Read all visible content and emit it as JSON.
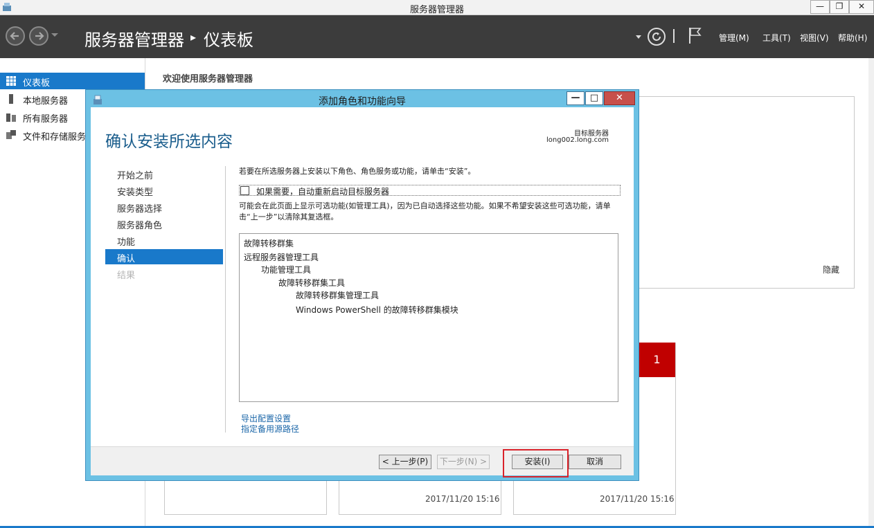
{
  "window": {
    "title": "服务器管理器",
    "controls": [
      "minimize",
      "maximize",
      "close"
    ]
  },
  "header": {
    "breadcrumb_root": "服务器管理器",
    "breadcrumb_sep": "▸",
    "breadcrumb_page": "仪表板",
    "menus": [
      "管理(M)",
      "工具(T)",
      "视图(V)",
      "帮助(H)"
    ]
  },
  "sidebar": {
    "items": [
      {
        "label": "仪表板",
        "icon": "dashboard-icon",
        "active": true
      },
      {
        "label": "本地服务器",
        "icon": "server-icon",
        "active": false
      },
      {
        "label": "所有服务器",
        "icon": "servers-icon",
        "active": false
      },
      {
        "label": "文件和存储服务",
        "icon": "storage-icon",
        "active": false
      }
    ]
  },
  "main": {
    "welcome_title": "欢迎使用服务器管理器",
    "hide_label": "隐藏",
    "badge_count": "1",
    "timestamps": [
      "2017/11/20 15:16",
      "2017/11/20 15:16"
    ]
  },
  "dialog": {
    "title": "添加角色和功能向导",
    "heading": "确认安装所选内容",
    "target_label": "目标服务器",
    "target_value": "long002.long.com",
    "steps": [
      {
        "label": "开始之前",
        "state": "normal"
      },
      {
        "label": "安装类型",
        "state": "normal"
      },
      {
        "label": "服务器选择",
        "state": "normal"
      },
      {
        "label": "服务器角色",
        "state": "normal"
      },
      {
        "label": "功能",
        "state": "normal"
      },
      {
        "label": "确认",
        "state": "active"
      },
      {
        "label": "结果",
        "state": "disabled"
      }
    ],
    "intro": "若要在所选服务器上安装以下角色、角色服务或功能，请单击“安装”。",
    "restart_checkbox_label": "如果需要，自动重新启动目标服务器",
    "restart_checked": false,
    "note": "可能会在此页面上显示可选功能(如管理工具)，因为已自动选择这些功能。如果不希望安装这些可选功能，请单击“上一步”以清除其复选框。",
    "features": [
      {
        "label": "故障转移群集",
        "level": 0
      },
      {
        "label": "远程服务器管理工具",
        "level": 0
      },
      {
        "label": "功能管理工具",
        "level": 1
      },
      {
        "label": "故障转移群集工具",
        "level": 2
      },
      {
        "label": "故障转移群集管理工具",
        "level": 3
      },
      {
        "label": "Windows PowerShell 的故障转移群集模块",
        "level": 3
      }
    ],
    "links": [
      "导出配置设置",
      "指定备用源路径"
    ],
    "buttons": {
      "prev": "< 上一步(P)",
      "next": "下一步(N) >",
      "install": "安装(I)",
      "cancel": "取消"
    }
  },
  "colors": {
    "header_bg": "#3c3c3c",
    "accent": "#1979ca",
    "dialog_frame": "#6cc1e4",
    "heading": "#1a5d8c",
    "badge": "#c00000",
    "highlight": "#d9222a"
  }
}
